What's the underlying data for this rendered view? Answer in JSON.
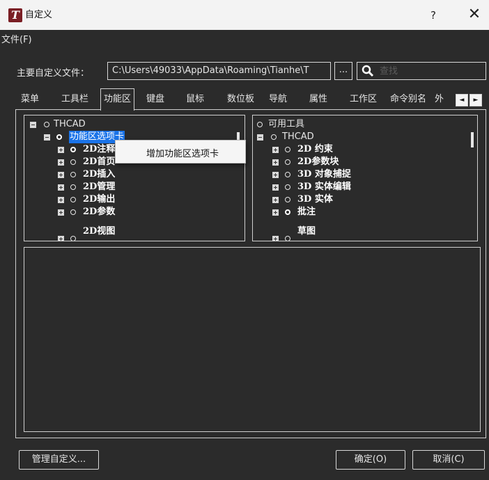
{
  "window": {
    "title": "自定义",
    "help_label": "?",
    "close_label": "✕",
    "app_icon_letter": "T"
  },
  "menubar": {
    "file": "文件(F)"
  },
  "main_file": {
    "label": "主要自定义文件：",
    "path": "C:\\Users\\49033\\AppData\\Roaming\\Tianhe\\T",
    "browse_label": "..."
  },
  "search": {
    "placeholder": "查找",
    "icon": "search-icon"
  },
  "tabs": {
    "items": [
      "菜单",
      "工具栏",
      "功能区",
      "键盘",
      "鼠标",
      "数位板",
      "导航",
      "属性",
      "工作区",
      "命令别名",
      "外"
    ],
    "active": "功能区",
    "scroll_left": "◄",
    "scroll_right": "►"
  },
  "left_tree": {
    "root": "THCAD",
    "selected": "功能区选项卡",
    "children": [
      "2D注释",
      "2D首页",
      "2D插入",
      "2D管理",
      "2D输出",
      "2D参数",
      "2D视图"
    ]
  },
  "right_tree": {
    "root": "可用工具",
    "sub_root": "THCAD",
    "children": [
      "2D 约束",
      "2D参数块",
      "3D 对象捕捉",
      "3D 实体编辑",
      "3D 实体",
      "批注",
      "草图"
    ]
  },
  "context_menu": {
    "item": "增加功能区选项卡"
  },
  "buttons": {
    "manage": "管理自定义...",
    "ok": "确定(O)",
    "cancel": "取消(C)"
  },
  "colors": {
    "background": "#2b2b2b",
    "titlebar": "#f3f3f3",
    "selection": "#1a73e8",
    "text": "#e6e6e6"
  }
}
